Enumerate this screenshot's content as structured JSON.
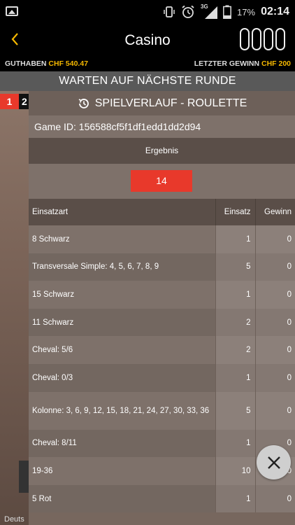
{
  "status_bar": {
    "network": "3G",
    "battery": "17%",
    "time": "02:14",
    "icons": [
      "image-icon",
      "vibrate-icon",
      "alarm-icon",
      "signal-icon",
      "battery-icon"
    ]
  },
  "header": {
    "title": "Casino",
    "back_icon": "chevron-left-icon",
    "counter_digits": 4
  },
  "balance": {
    "guthaben_label": "GUTHABEN",
    "guthaben_value": "CHF 540.47",
    "gewinn_label": "LETZTER GEWINN",
    "gewinn_value": "CHF 200"
  },
  "waiting_banner": "WARTEN AUF NÄCHSTE RUNDE",
  "background": {
    "badge_1": "1",
    "badge_2": "2",
    "lang_text": "Deuts"
  },
  "panel": {
    "title": "SPIELVERLAUF - ROULETTE",
    "game_id": "Game ID: 156588cf5f1df1edd1dd2d94",
    "ergebnis_label": "Ergebnis",
    "result": "14",
    "columns": {
      "einsatzart": "Einsatzart",
      "einsatz": "Einsatz",
      "gewinn": "Gewinn"
    },
    "rows": [
      {
        "type": "8 Schwarz",
        "einsatz": "1",
        "gewinn": "0"
      },
      {
        "type": "Transversale Simple: 4, 5, 6, 7, 8, 9",
        "einsatz": "5",
        "gewinn": "0"
      },
      {
        "type": "15 Schwarz",
        "einsatz": "1",
        "gewinn": "0"
      },
      {
        "type": "11 Schwarz",
        "einsatz": "2",
        "gewinn": "0"
      },
      {
        "type": "Cheval: 5/6",
        "einsatz": "2",
        "gewinn": "0"
      },
      {
        "type": "Cheval: 0/3",
        "einsatz": "1",
        "gewinn": "0"
      },
      {
        "type": "Kolonne: 3, 6, 9, 12, 15, 18, 21, 24, 27, 30, 33, 36",
        "einsatz": "5",
        "gewinn": "0"
      },
      {
        "type": "Cheval: 8/11",
        "einsatz": "1",
        "gewinn": "0"
      },
      {
        "type": "19-36",
        "einsatz": "10",
        "gewinn": "0"
      },
      {
        "type": "5 Rot",
        "einsatz": "1",
        "gewinn": "0"
      }
    ]
  },
  "close_icon": "close-icon",
  "colors": {
    "accent": "#f5b800",
    "result_red": "#e8392b"
  }
}
